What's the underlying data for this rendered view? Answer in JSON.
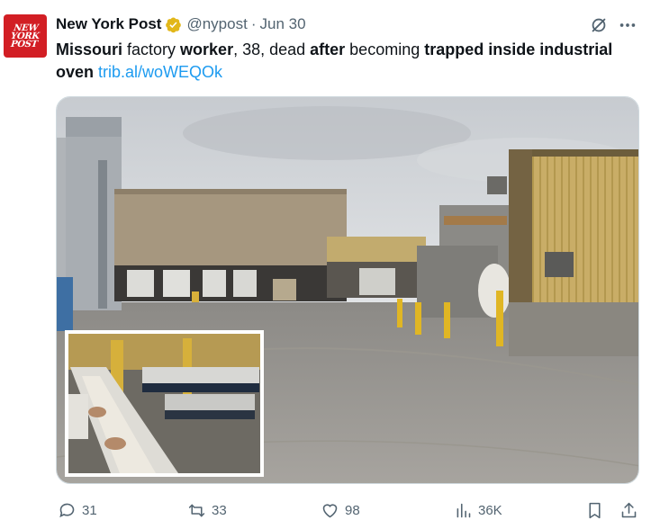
{
  "author": {
    "avatar_text": [
      "NEW",
      "YORK",
      "POST"
    ],
    "display_name": "New York Post",
    "handle": "@nypost",
    "separator": "·",
    "date": "Jun 30",
    "verified_badge_color": "#e2b719"
  },
  "tweet": {
    "segments": [
      {
        "text": "Missouri",
        "bold": true
      },
      {
        "text": " factory ",
        "bold": false
      },
      {
        "text": "worker",
        "bold": true
      },
      {
        "text": ", 38, dead ",
        "bold": false
      },
      {
        "text": "after",
        "bold": true
      },
      {
        "text": " becoming ",
        "bold": false
      },
      {
        "text": "trapped inside industrial oven",
        "bold": true
      },
      {
        "text": " ",
        "bold": false
      }
    ],
    "link": "trib.al/woWEQOk"
  },
  "actions": {
    "replies": "31",
    "reposts": "33",
    "likes": "98",
    "views": "36K"
  },
  "icons": {
    "grok": "grok-icon",
    "more": "more-icon",
    "reply": "reply-icon",
    "repost": "repost-icon",
    "like": "heart-icon",
    "views": "views-icon",
    "bookmark": "bookmark-icon",
    "share": "share-icon"
  },
  "colors": {
    "link": "#1d9bf0",
    "secondary_text": "#536471",
    "brand_red": "#d21e24"
  }
}
